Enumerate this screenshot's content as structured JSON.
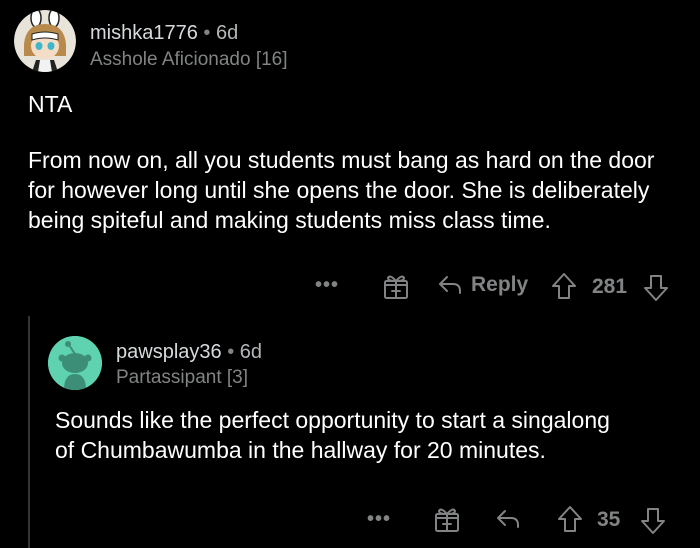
{
  "comments": [
    {
      "username": "mishka1776",
      "separator": "•",
      "age": "6d",
      "flair": "Asshole Aficionado [16]",
      "paragraphs": [
        "NTA",
        "From now on, all you students must bang as hard on the door for however long until she opens the door. She is deliberately being spiteful and making students miss class time."
      ],
      "actions": {
        "more": "•••",
        "reply_label": "Reply",
        "score": "281"
      },
      "avatar_icon": "anime-avatar-icon"
    },
    {
      "username": "pawsplay36",
      "separator": "•",
      "age": "6d",
      "flair": "Partassipant [3]",
      "paragraphs": [
        "Sounds like the perfect opportunity to start a singalong of Chumbawumba in the hallway for 20 minutes."
      ],
      "actions": {
        "more": "•••",
        "score": "35"
      },
      "avatar_icon": "snoo-avatar-icon"
    }
  ],
  "colors": {
    "background": "#000000",
    "text": "#ffffff",
    "muted": "#818384",
    "snoo_bg": "#5fd3b0"
  }
}
